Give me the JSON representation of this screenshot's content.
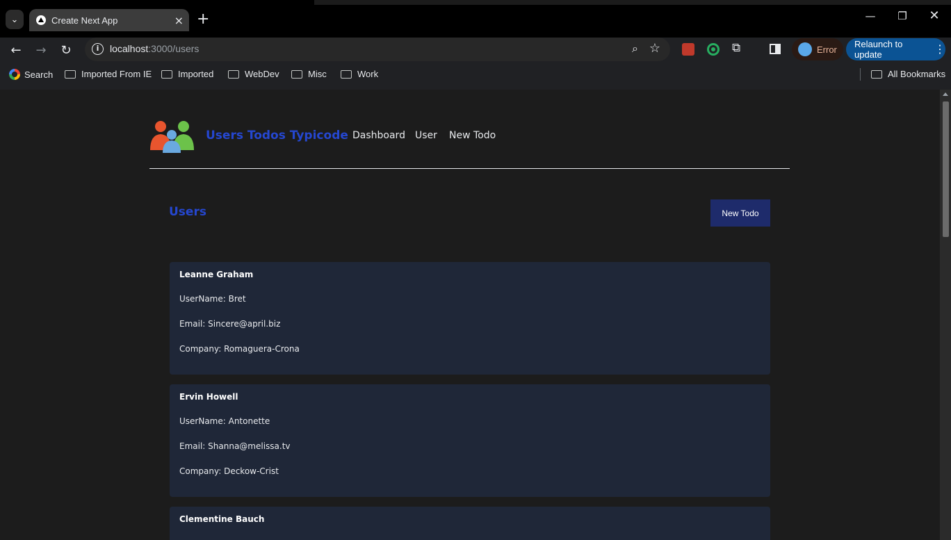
{
  "browser": {
    "tab_title": "Create Next App",
    "url_host": "localhost",
    "url_path": ":3000/users",
    "profile_status": "Error",
    "relaunch_label": "Relaunch to update",
    "bookmarks": [
      "Search",
      "Imported From IE",
      "Imported",
      "WebDev",
      "Misc",
      "Work"
    ],
    "all_bookmarks": "All Bookmarks"
  },
  "header": {
    "brand": "Users Todos Typicode",
    "nav": [
      "Dashboard",
      "User",
      "New Todo"
    ]
  },
  "main": {
    "title": "Users",
    "new_todo_label": "New Todo",
    "users": [
      {
        "name": "Leanne Graham",
        "username": "UserName: Bret",
        "email": "Email: Sincere@april.biz",
        "company": "Company: Romaguera-Crona"
      },
      {
        "name": "Ervin Howell",
        "username": "UserName: Antonette",
        "email": "Email: Shanna@melissa.tv",
        "company": "Company: Deckow-Crist"
      },
      {
        "name": "Clementine Bauch"
      }
    ]
  }
}
